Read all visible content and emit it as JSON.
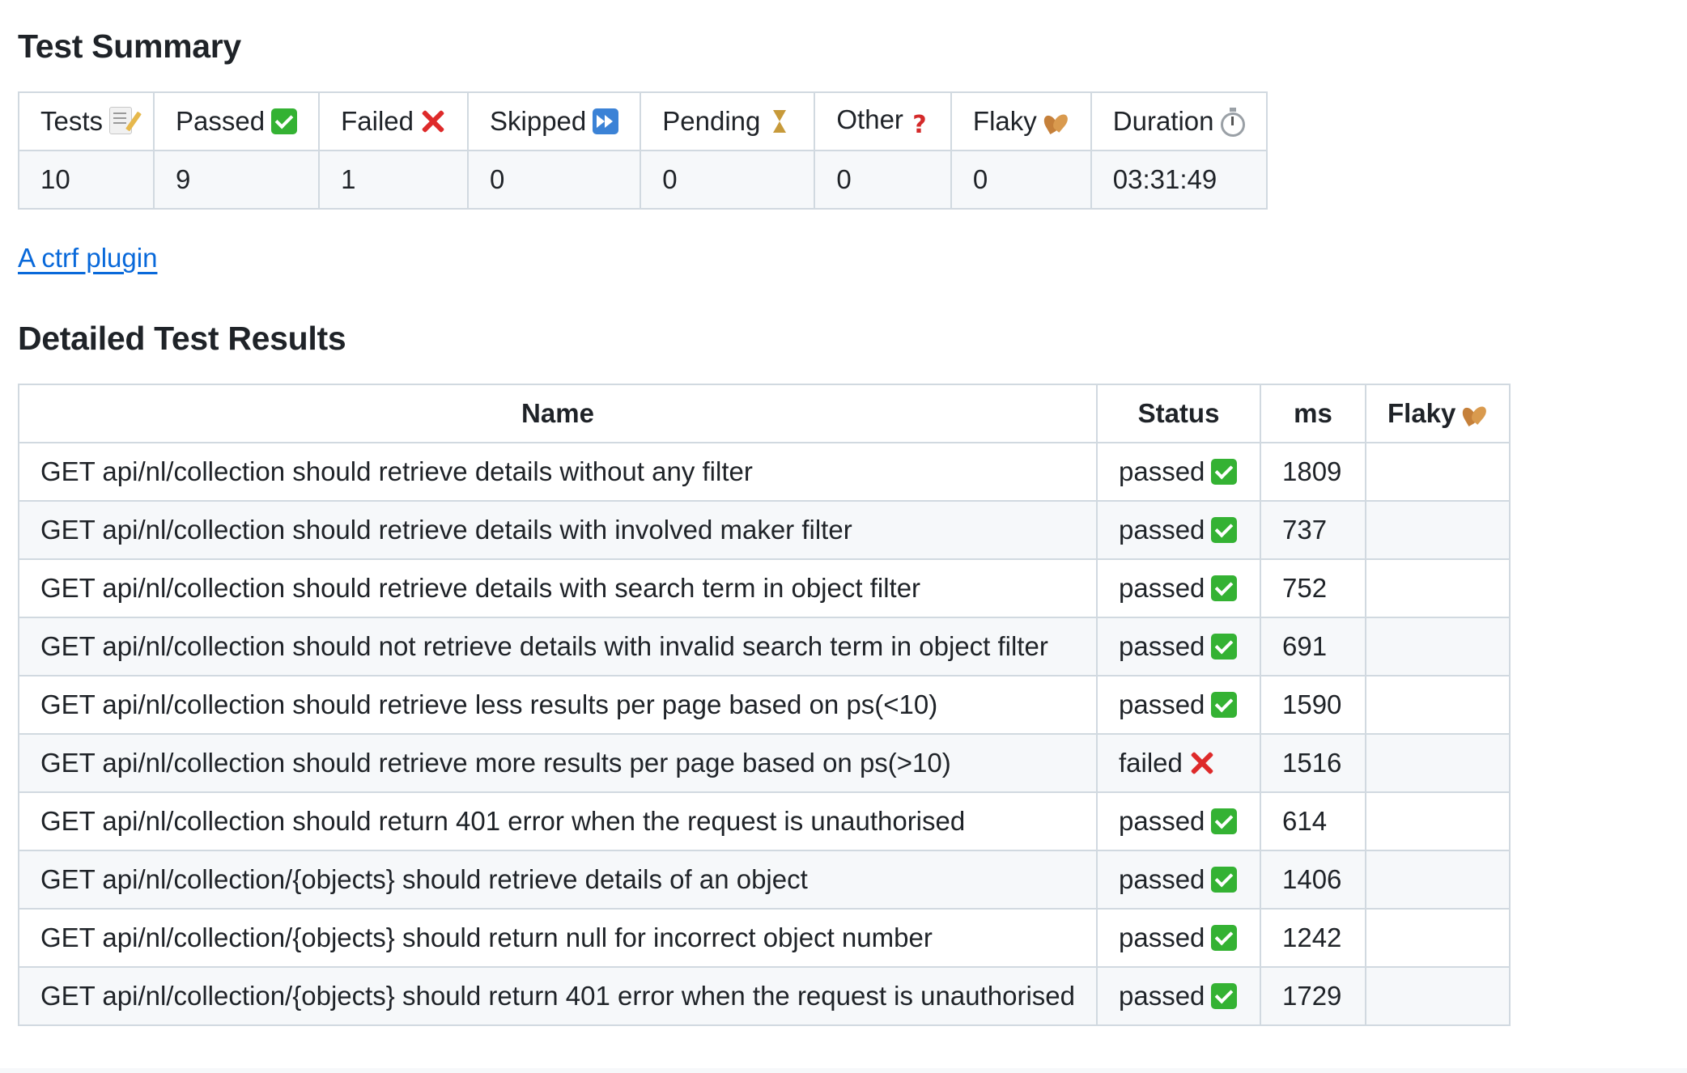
{
  "summary": {
    "heading": "Test Summary",
    "columns": [
      {
        "label": "Tests",
        "icon": "memo-icon"
      },
      {
        "label": "Passed",
        "icon": "check-icon"
      },
      {
        "label": "Failed",
        "icon": "cross-icon"
      },
      {
        "label": "Skipped",
        "icon": "skip-icon"
      },
      {
        "label": "Pending",
        "icon": "hourglass-icon"
      },
      {
        "label": "Other",
        "icon": "question-icon"
      },
      {
        "label": "Flaky",
        "icon": "leaves-icon"
      },
      {
        "label": "Duration",
        "icon": "stopwatch-icon"
      }
    ],
    "values": [
      "10",
      "9",
      "1",
      "0",
      "0",
      "0",
      "0",
      "03:31:49"
    ]
  },
  "plugin_link": {
    "label": "A ctrf plugin"
  },
  "details": {
    "heading": "Detailed Test Results",
    "columns": {
      "name": "Name",
      "status": "Status",
      "ms": "ms",
      "flaky": "Flaky"
    },
    "rows": [
      {
        "name": "GET api/nl/collection should retrieve details without any filter",
        "status": "passed",
        "ms": "1809",
        "flaky": ""
      },
      {
        "name": "GET api/nl/collection should retrieve details with involved maker filter",
        "status": "passed",
        "ms": "737",
        "flaky": ""
      },
      {
        "name": "GET api/nl/collection should retrieve details with search term in object filter",
        "status": "passed",
        "ms": "752",
        "flaky": ""
      },
      {
        "name": "GET api/nl/collection should not retrieve details with invalid search term in object filter",
        "status": "passed",
        "ms": "691",
        "flaky": ""
      },
      {
        "name": "GET api/nl/collection should retrieve less results per page based on ps(<10)",
        "status": "passed",
        "ms": "1590",
        "flaky": ""
      },
      {
        "name": "GET api/nl/collection should retrieve more results per page based on ps(>10)",
        "status": "failed",
        "ms": "1516",
        "flaky": ""
      },
      {
        "name": "GET api/nl/collection should return 401 error when the request is unauthorised",
        "status": "passed",
        "ms": "614",
        "flaky": ""
      },
      {
        "name": "GET api/nl/collection/{objects} should retrieve details of an object",
        "status": "passed",
        "ms": "1406",
        "flaky": ""
      },
      {
        "name": "GET api/nl/collection/{objects} should return null for incorrect object number",
        "status": "passed",
        "ms": "1242",
        "flaky": ""
      },
      {
        "name": "GET api/nl/collection/{objects} should return 401 error when the request is unauthorised",
        "status": "passed",
        "ms": "1729",
        "flaky": ""
      }
    ]
  },
  "colors": {
    "link": "#0969da",
    "border": "#d1d9e0",
    "stripe": "#f6f8fa",
    "passed": "#34b233",
    "failed": "#de2a2a"
  }
}
